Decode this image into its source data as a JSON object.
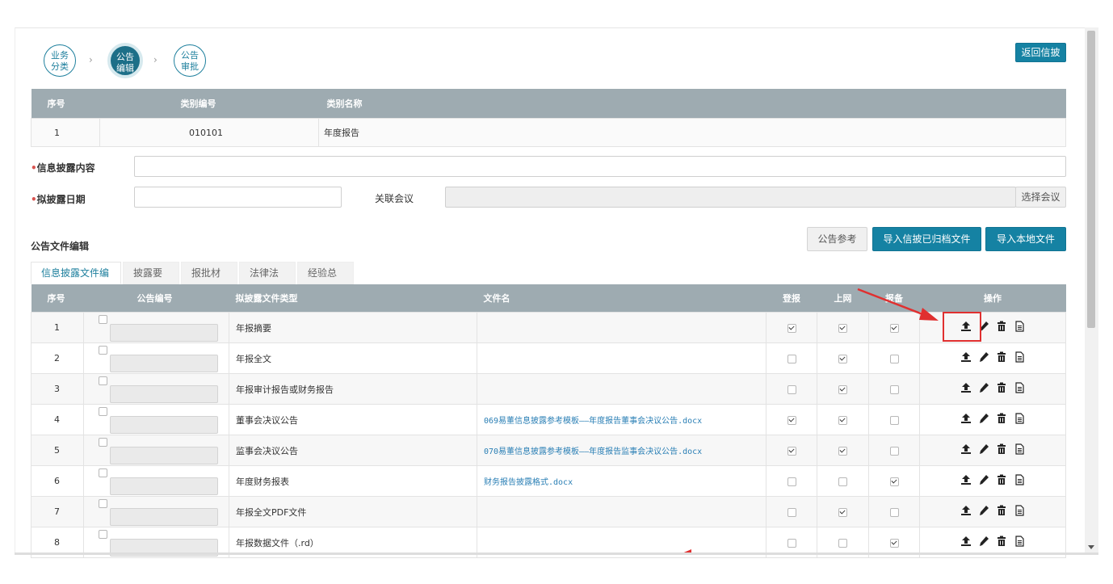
{
  "steps": [
    {
      "label": "业务分类",
      "line1": "业务",
      "line2": "分类",
      "state": "inactive"
    },
    {
      "label": "公告编辑",
      "line1": "公告",
      "line2": "编辑",
      "state": "active"
    },
    {
      "label": "公告审批",
      "line1": "公告",
      "line2": "审批",
      "state": "inactive"
    }
  ],
  "header": {
    "back_label": "返回信披"
  },
  "category_table": {
    "headers": [
      "序号",
      "类别编号",
      "类别名称"
    ],
    "rows": [
      [
        "1",
        "010101",
        "年度报告"
      ]
    ]
  },
  "form": {
    "content_label": "信息披露内容",
    "date_label": "拟披露日期",
    "meeting_label": "关联会议",
    "select_meeting_label": "选择会议",
    "content_value": "",
    "date_value": "",
    "meeting_value": ""
  },
  "doc_section": {
    "title": "公告文件编辑",
    "ref_label": "公告参考",
    "import_archive_label": "导入信披已归档文件",
    "import_local_label": "导入本地文件"
  },
  "tabs": [
    "信息披露文件编辑",
    "披露要点",
    "报批材料",
    "法律法规",
    "经验总结"
  ],
  "doc_table": {
    "headers": [
      "序号",
      "公告编号",
      "拟披露文件类型",
      "文件名",
      "登报",
      "上网",
      "报备",
      "操作"
    ],
    "rows": [
      {
        "no": "1",
        "type": "年报摘要",
        "file": "",
        "paper": true,
        "online": true,
        "filed": true
      },
      {
        "no": "2",
        "type": "年报全文",
        "file": "",
        "paper": false,
        "online": true,
        "filed": false
      },
      {
        "no": "3",
        "type": "年报审计报告或财务报告",
        "file": "",
        "paper": false,
        "online": true,
        "filed": false
      },
      {
        "no": "4",
        "type": "董事会决议公告",
        "file": "069易董信息披露参考模板——年度报告董事会决议公告.docx",
        "paper": true,
        "online": true,
        "filed": false
      },
      {
        "no": "5",
        "type": "监事会决议公告",
        "file": "070易董信息披露参考模板——年度报告监事会决议公告.docx",
        "paper": true,
        "online": true,
        "filed": false
      },
      {
        "no": "6",
        "type": "年度财务报表",
        "file": "财务报告披露格式.docx",
        "paper": false,
        "online": false,
        "filed": true
      },
      {
        "no": "7",
        "type": "年报全文PDF文件",
        "file": "",
        "paper": false,
        "online": true,
        "filed": false
      },
      {
        "no": "8",
        "type": "年报数据文件（.rd）",
        "file": "",
        "paper": false,
        "online": false,
        "filed": true
      }
    ]
  },
  "icons": {
    "upload": "upload-icon",
    "edit": "pencil-icon",
    "delete": "trash-icon",
    "view": "document-icon"
  },
  "colors": {
    "accent": "#1582a3",
    "header_bg": "#9eabb1",
    "annotation": "#e03030"
  }
}
